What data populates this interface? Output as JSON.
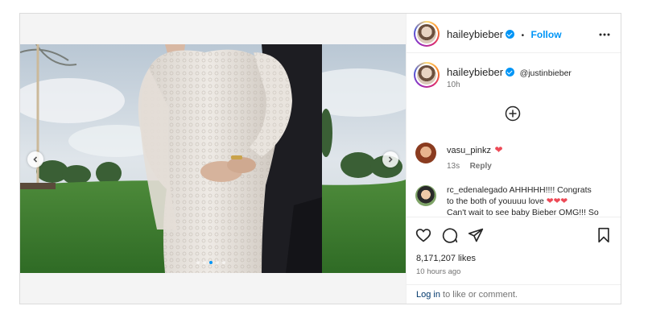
{
  "post": {
    "author": {
      "username": "haileybieber",
      "verified": true,
      "separator": "•",
      "follow_label": "Follow"
    },
    "more_icon": "more-horizontal-icon",
    "caption": {
      "username": "haileybieber",
      "mention": "@justinbieber",
      "time": "10h"
    },
    "load_more_icon": "plus-circle-icon",
    "comments": [
      {
        "username": "vasu_pinkz",
        "text": "❤",
        "time": "13s",
        "reply_label": "Reply"
      },
      {
        "username": "rc_edenalegado",
        "text_line1": "AHHHHH!!!! Congrats",
        "text_line2": "to the both of youuuu love",
        "emojis_line2": "❤❤❤",
        "text_line3": "Can't wait to see baby Bieber OMG!!! So"
      }
    ],
    "actions": {
      "like_icon": "heart-icon",
      "comment_icon": "comment-icon",
      "share_icon": "share-icon",
      "save_icon": "bookmark-icon"
    },
    "likes": "8,171,207 likes",
    "posted": "10 hours ago",
    "footer": {
      "login_label": "Log in",
      "rest": " to like or comment."
    },
    "carousel": {
      "prev_icon": "chevron-left-icon",
      "next_icon": "chevron-right-icon",
      "slide_count": 5,
      "active_slide": 3
    },
    "colors": {
      "accent": "#0095f6",
      "heart": "#ed4956",
      "mention": "#00376b",
      "muted": "#737373"
    }
  }
}
